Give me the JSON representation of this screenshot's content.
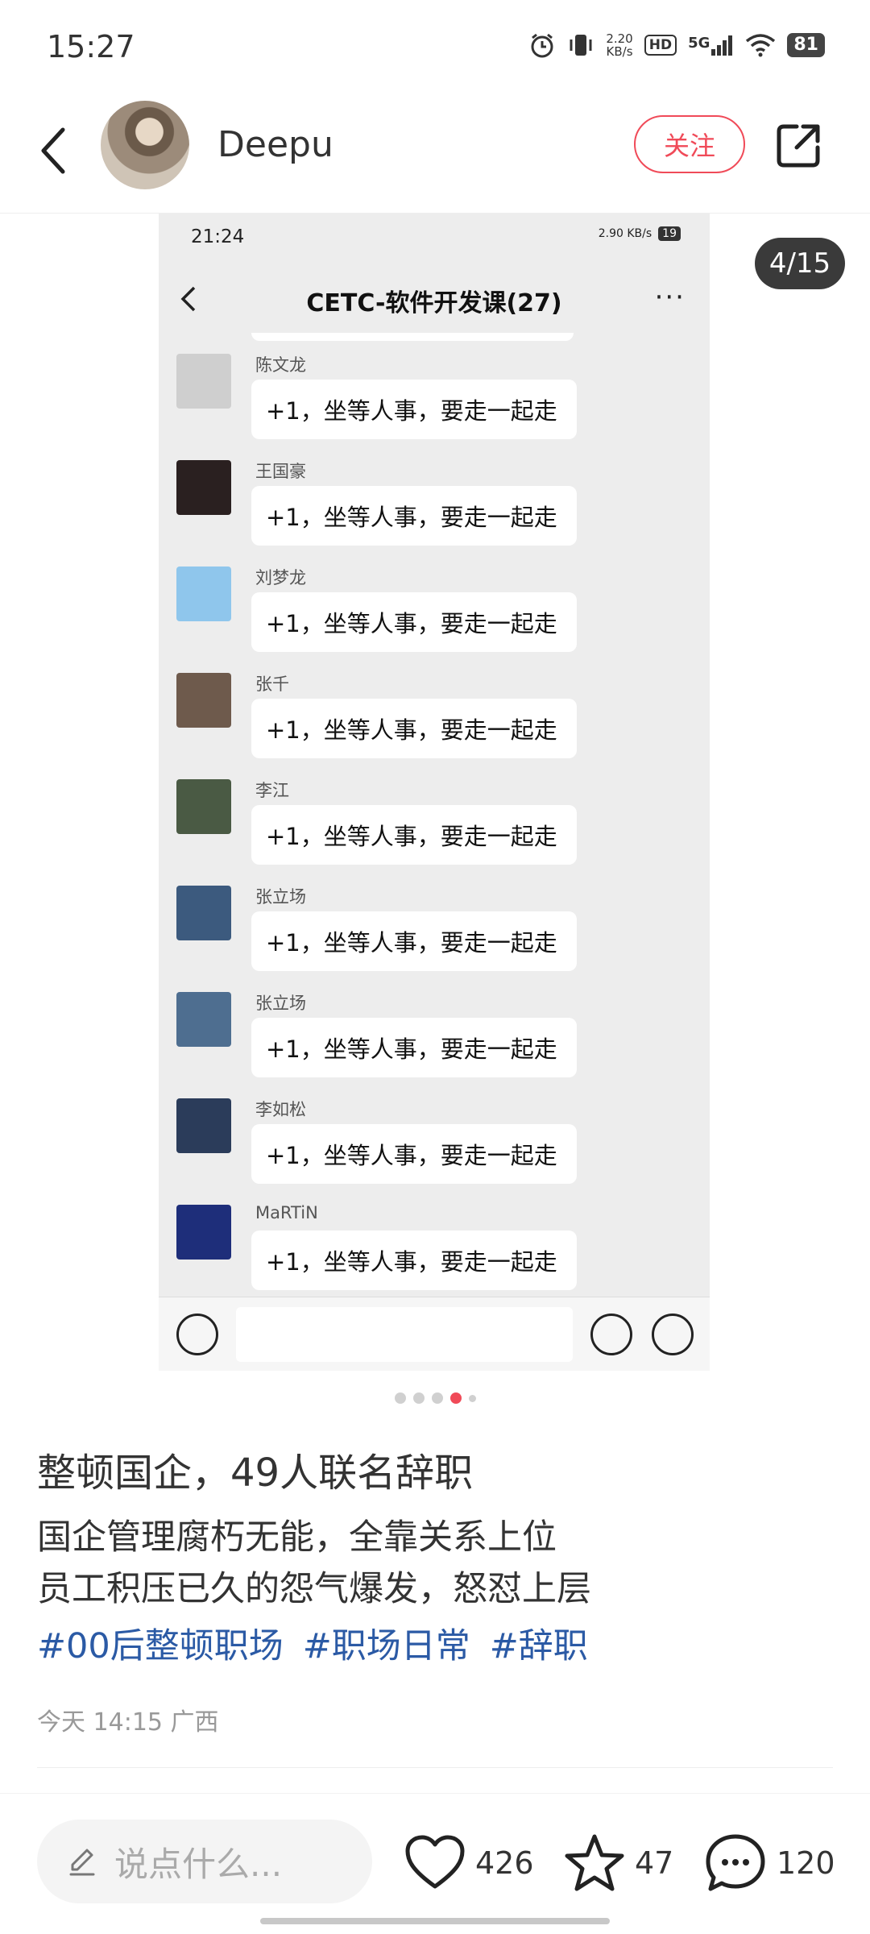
{
  "status_bar": {
    "time": "15:27",
    "net_speed_value": "2.20",
    "net_speed_unit": "KB/s",
    "hd_label": "HD",
    "network_label": "5G",
    "battery": "81"
  },
  "header": {
    "author_name": "Deepu",
    "follow_label": "关注"
  },
  "carousel": {
    "page_counter": "4/15",
    "current_page": 4,
    "total_pages": 15,
    "dots_total": 5,
    "dots_active_index": 3,
    "screenshot": {
      "time": "21:24",
      "net_speed": "2.90 KB/s",
      "battery": "19",
      "chat_title": "CETC-软件开发课(27)",
      "more_label": "···",
      "messages": [
        {
          "name": "陈文龙",
          "text": "+1，坐等人事，要走一起走",
          "avatar_color": "#cfcfcf"
        },
        {
          "name": "王国豪",
          "text": "+1，坐等人事，要走一起走",
          "avatar_color": "#2a2020"
        },
        {
          "name": "刘梦龙",
          "text": "+1，坐等人事，要走一起走",
          "avatar_color": "#8fc6ec"
        },
        {
          "name": "张千",
          "text": "+1，坐等人事，要走一起走",
          "avatar_color": "#6e5a4c"
        },
        {
          "name": "李江",
          "text": "+1，坐等人事，要走一起走",
          "avatar_color": "#4a5a44"
        },
        {
          "name": "张立场",
          "text": "+1，坐等人事，要走一起走",
          "avatar_color": "#3c5a7e"
        },
        {
          "name": "张立场",
          "text": "+1，坐等人事，要走一起走",
          "avatar_color": "#4e6e90"
        },
        {
          "name": "李如松",
          "text": "+1，坐等人事，要走一起走",
          "avatar_color": "#2b3c5a"
        },
        {
          "name": "MaRTiN",
          "text": "+1，坐等人事，要走一起走",
          "avatar_color": "#1e2e7a"
        }
      ]
    }
  },
  "post": {
    "title": "整顿国企，49人联名辞职",
    "body_line1": "国企管理腐朽无能，全靠关系上位",
    "body_line2": "员工积压已久的怨气爆发，怒怼上层",
    "tags": [
      "#00后整顿职场",
      "#职场日常",
      "#辞职"
    ],
    "meta": "今天 14:15 广西"
  },
  "bottom_bar": {
    "comment_placeholder": "说点什么...",
    "likes": "426",
    "favorites": "47",
    "comments": "120"
  },
  "colors": {
    "accent": "#f04a58",
    "tag": "#2b5aa5"
  }
}
